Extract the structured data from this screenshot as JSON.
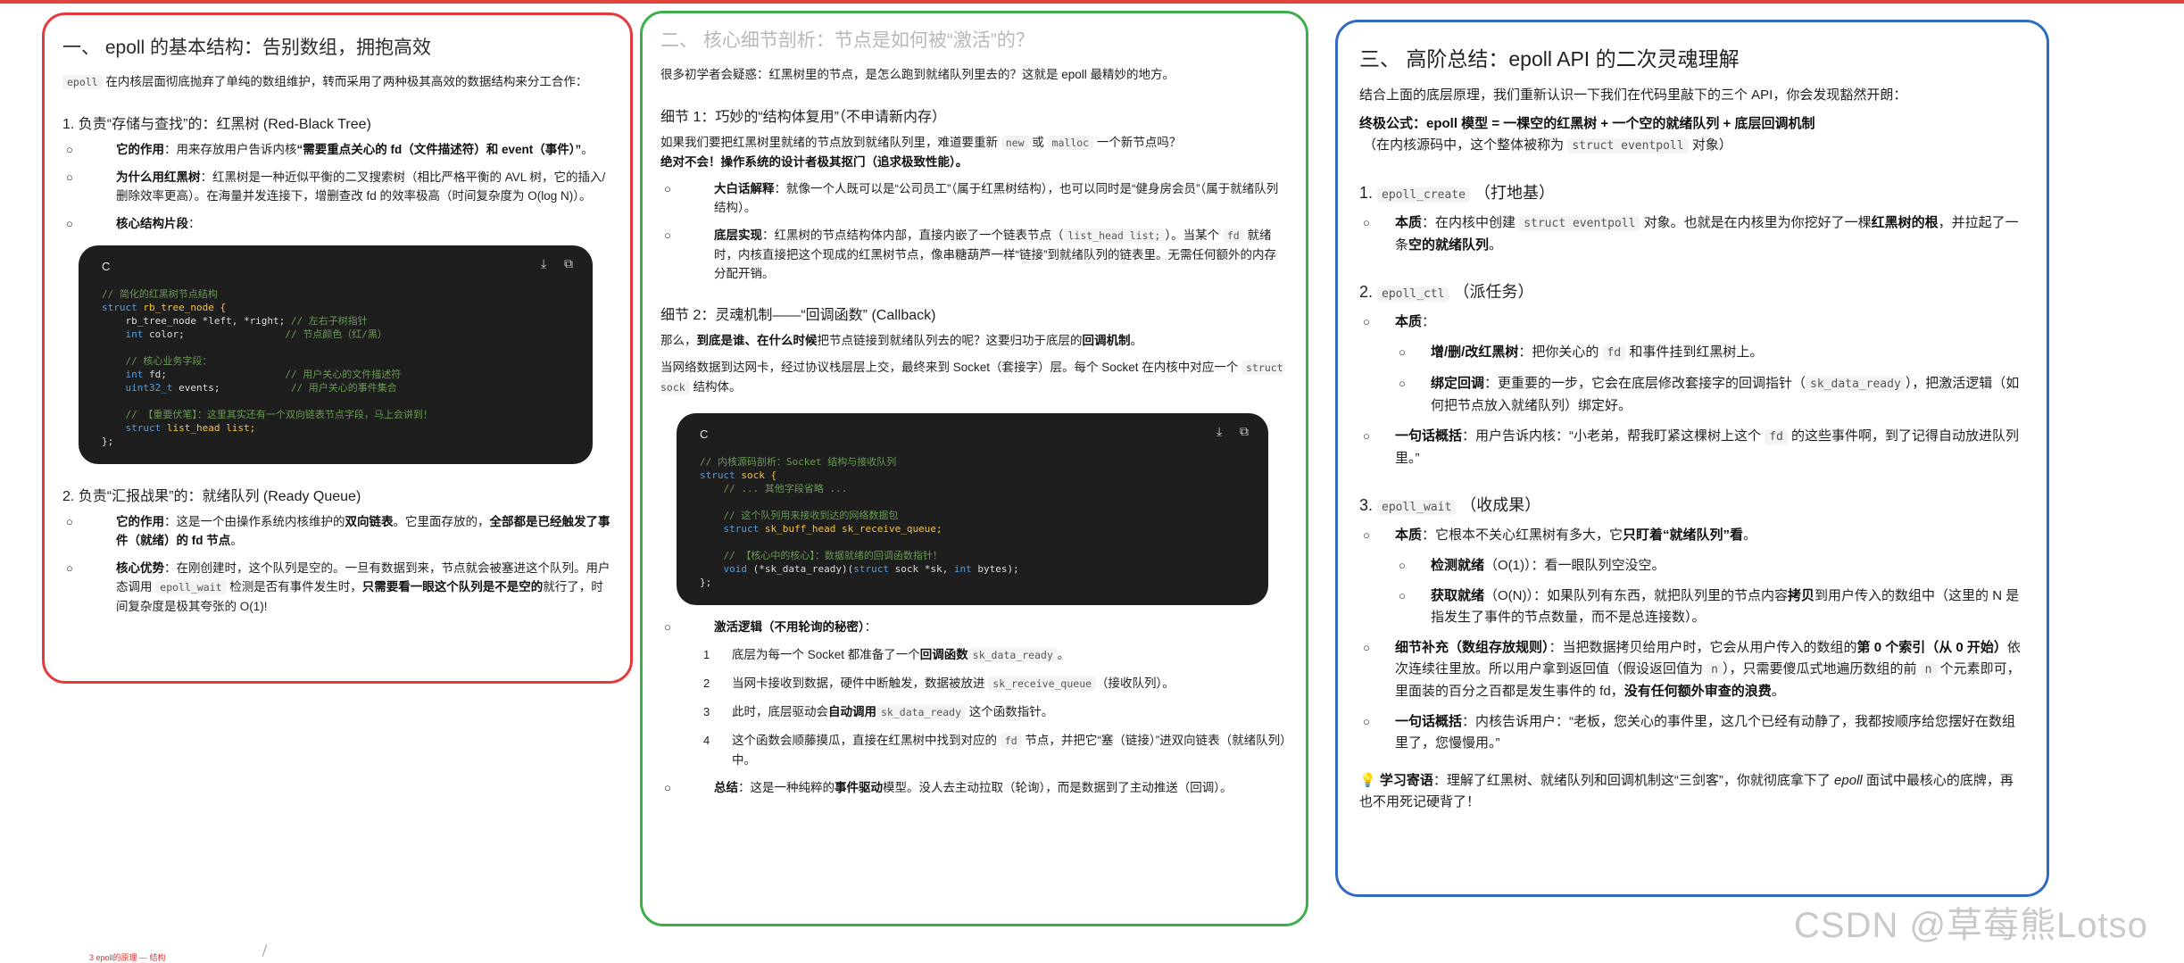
{
  "p1": {
    "title": "一、 epoll 的基本结构：告别数组，拥抱高效",
    "intro_code": "epoll",
    "intro": " 在内核层面彻底抛弃了单纯的数组维护，转而采用了两种极其高效的数据结构来分工合作：",
    "s1_title": "1. 负责“存储与查找”的：红黑树 (Red-Black Tree)",
    "s1_b1_label": "它的作用",
    "s1_b1_text": "：用来存放用户告诉内核",
    "s1_b1_bold": "“需要重点关心的 fd（文件描述符）和 event（事件）”",
    "s1_b1_end": "。",
    "s1_b2_label": "为什么用红黑树",
    "s1_b2_text": "：红黑树是一种近似平衡的二叉搜索树（相比严格平衡的 AVL 树，它的插入/删除效率更高）。在海量并发连接下，增删查改 fd 的效率极高（时间复杂度为 O(log N)）。",
    "s1_b3_label": "核心结构片段",
    "s1_b3_end": "：",
    "code1_lang": "C",
    "s2_title": "2. 负责“汇报战果”的：就绪队列 (Ready Queue)",
    "s2_b1_label": "它的作用",
    "s2_b1_text": "：这是一个由操作系统内核维护的",
    "s2_b1_bold": "双向链表",
    "s2_b1_text2": "。它里面存放的，",
    "s2_b1_bold2": "全部都是已经触发了事件（就绪）的 fd 节点",
    "s2_b1_end": "。",
    "s2_b2_label": "核心优势",
    "s2_b2_text": "：在刚创建时，这个队列是空的。一旦有数据到来，节点就会被塞进这个队列。用户态调用 ",
    "s2_b2_code": "epoll_wait",
    "s2_b2_text2": " 检测是否有事件发生时，",
    "s2_b2_bold": "只需要看一眼这个队列是不是空的",
    "s2_b2_end": "就行了，时间复杂度是极其夸张的 O(1)!"
  },
  "p2": {
    "title": "二、 核心细节剖析：节点是如何被“激活”的？",
    "intro": "很多初学者会疑惑：红黑树里的节点，是怎么跑到就绪队列里去的？这就是 epoll 最精妙的地方。",
    "d1_title": "细节 1：巧妙的“结构体复用”（不申请新内存）",
    "d1_p1a": "如果我们要把红黑树里就绪的节点放到就绪队列里，难道要重新 ",
    "d1_code_new": "new",
    "d1_p1b": " 或 ",
    "d1_code_malloc": "malloc",
    "d1_p1c": " 一个新节点吗？",
    "d1_p1_bold": "绝对不会！操作系统的设计者极其抠门（追求极致性能）。",
    "d1_b1_label": "大白话解释",
    "d1_b1_text": "：就像一个人既可以是“公司员工”（属于红黑树结构），也可以同时是“健身房会员”（属于就绪队列结构）。",
    "d1_b2_label": "底层实现",
    "d1_b2_text": "：红黑树的节点结构体内部，直接内嵌了一个链表节点（",
    "d1_b2_code": "list_head list;",
    "d1_b2_text2": "）。当某个 ",
    "d1_b2_code2": "fd",
    "d1_b2_text3": " 就绪时，内核直接把这个现成的红黑树节点，像串糖葫芦一样“链接”到就绪队列的链表里。无需任何额外的内存分配开销。",
    "d2_title": "细节 2：灵魂机制——“回调函数” (Callback)",
    "d2_p1a": "那么，",
    "d2_p1_bold": "到底是谁、在什么时候",
    "d2_p1b": "把节点链接到就绪队列去的呢？这要归功于底层的",
    "d2_p1_bold2": "回调机制",
    "d2_p1c": "。",
    "d2_p2a": "当网络数据到达网卡，经过协议栈层层上交，最终来到 Socket（套接字）层。每个 Socket 在内核中对应一个 ",
    "d2_p2_code": "struct sock",
    "d2_p2b": " 结构体。",
    "code2_lang": "C",
    "act_label": "激活逻辑（不用轮询的秘密）",
    "act_end": "：",
    "steps": [
      {
        "n": "1",
        "a": "底层为每一个 Socket 都准备了一个",
        "b": "回调函数",
        "c": "sk_data_ready",
        "d": "。"
      },
      {
        "n": "2",
        "a": "当网卡接收到数据，硬件中断触发，数据被放进 ",
        "b": "",
        "c": "sk_receive_queue",
        "d": "（接收队列）。"
      },
      {
        "n": "3",
        "a": "此时，底层驱动会",
        "b": "自动调用",
        "c": "sk_data_ready",
        "d": " 这个函数指针。"
      },
      {
        "n": "4",
        "a": "这个函数会顺藤摸瓜，直接在红黑树中找到对应的 ",
        "b": "",
        "c": "fd",
        "d": " 节点，并把它“塞（链接）”进双向链表（就绪队列）中。"
      }
    ],
    "sum_label": "总结",
    "sum_text": "：这是一种纯粹的",
    "sum_bold": "事件驱动",
    "sum_text2": "模型。没人去主动拉取（轮询），而是数据到了主动推送（回调）。"
  },
  "p3": {
    "title": "三、 高阶总结：epoll API 的二次灵魂理解",
    "intro": "结合上面的底层原理，我们重新认识一下我们在代码里敲下的三个 API，你会发现豁然开朗：",
    "formula": "终极公式：epoll 模型 = 一棵空的红黑树 + 一个空的就绪队列 + 底层回调机制",
    "formula_sub_a": "（在内核源码中，这个整体被称为 ",
    "formula_sub_code": "struct eventpoll",
    "formula_sub_b": " 对象）",
    "a1_code": "epoll_create",
    "a1_title": "（打地基）",
    "a1_label": "本质",
    "a1_text": "：在内核中创建 ",
    "a1_code2": "struct eventpoll",
    "a1_text2": " 对象。也就是在内核里为你挖好了一棵",
    "a1_bold": "红黑树的根",
    "a1_text3": "，并拉起了一条",
    "a1_bold2": "空的就绪队列",
    "a1_end": "。",
    "a2_code": "epoll_ctl",
    "a2_title": "（派任务）",
    "a2_label": "本质",
    "a2_s1_label": "增/删/改红黑树",
    "a2_s1_text": "：把你关心的 ",
    "a2_s1_code": "fd",
    "a2_s1_text2": " 和事件挂到红黑树上。",
    "a2_s2_label": "绑定回调",
    "a2_s2_text": "：更重要的一步，它会在底层修改套接字的回调指针（",
    "a2_s2_code": "sk_data_ready",
    "a2_s2_text2": "），把激活逻辑（如何把节点放入就绪队列）绑定好。",
    "a2_sum_label": "一句话概括",
    "a2_sum_text": "：用户告诉内核：“小老弟，帮我盯紧这棵树上这个 ",
    "a2_sum_code": "fd",
    "a2_sum_text2": " 的这些事件啊，到了记得自动放进队列里。”",
    "a3_code": "epoll_wait",
    "a3_title": "（收成果）",
    "a3_label": "本质",
    "a3_text": "：它根本不关心红黑树有多大，它",
    "a3_bold": "只盯着“就绪队列”看",
    "a3_end": "。",
    "a3_s1_label": "检测就绪",
    "a3_s1_text": "（O(1)）：看一眼队列空没空。",
    "a3_s2_label": "获取就绪",
    "a3_s2_text": "（O(N)）：如果队列有东西，就把队列里的节点内容",
    "a3_s2_bold": "拷贝",
    "a3_s2_text2": "到用户传入的数组中（这里的 N 是指发生了事件的节点数量，而不是总连接数）。",
    "a3_b2_label": "细节补充（数组存放规则）",
    "a3_b2_text": "：当把数据拷贝给用户时，它会从用户传入的数组的",
    "a3_b2_bold": "第 0 个索引（从 0 开始）",
    "a3_b2_text2": "依次连续往里放。所以用户拿到返回值（假设返回值为 ",
    "a3_b2_code": "n",
    "a3_b2_text3": "），只需要傻瓜式地遍历数组的前 ",
    "a3_b2_code2": "n",
    "a3_b2_text4": " 个元素即可，里面装的百分之百都是发生事件的 fd，",
    "a3_b2_bold2": "没有任何额外审查的浪费",
    "a3_b2_end": "。",
    "a3_sum_label": "一句话概括",
    "a3_sum_text": "：内核告诉用户：“老板，您关心的事件里，这几个已经有动静了，我都按顺序给您摆好在数组里了，您慢慢用。”",
    "tip_icon": "💡",
    "tip_label": "学习寄语",
    "tip_text": "：理解了红黑树、就绪队列和回调机制这“三剑客”，你就彻底拿下了 ",
    "tip_em": "epoll",
    "tip_text2": " 面试中最核心的底牌，再也不用死记硬背了！"
  },
  "watermark": "CSDN @草莓熊Lotso",
  "footer_tiny": "3 epoll的原理 — 结构",
  "icons": {
    "download": "download-icon",
    "copy": "copy-icon",
    "bulb": "lightbulb-icon"
  }
}
